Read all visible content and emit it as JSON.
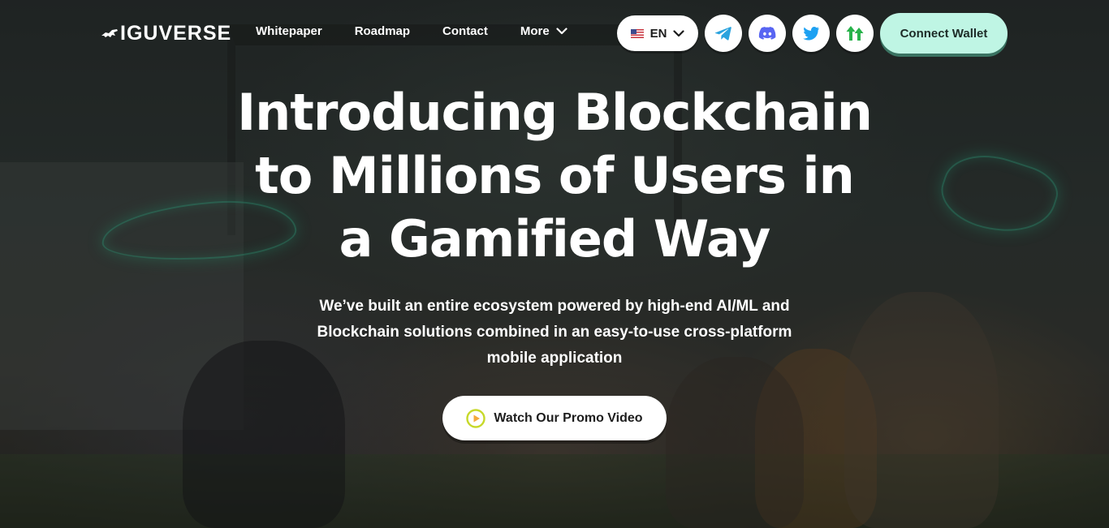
{
  "brand": {
    "logo_text": "IGUVERSE"
  },
  "nav": {
    "items": [
      {
        "label": "Whitepaper"
      },
      {
        "label": "Roadmap"
      },
      {
        "label": "Contact"
      },
      {
        "label": "More",
        "icon": "chevron-down-icon"
      }
    ]
  },
  "language": {
    "flag": "us-flag-icon",
    "label": "EN",
    "icon": "chevron-down-icon"
  },
  "social": [
    {
      "icon": "telegram-icon",
      "color": "#2aa3de"
    },
    {
      "icon": "discord-icon",
      "color": "#5865f2"
    },
    {
      "icon": "twitter-icon",
      "color": "#1da1f2"
    },
    {
      "icon": "upvote-arrows-icon",
      "color": "#27b24a"
    }
  ],
  "connect_wallet": {
    "label": "Connect Wallet",
    "color": "#bff5e4"
  },
  "hero": {
    "title_lines": [
      "Introducing Blockchain",
      "to Millions of Users in",
      "a Gamified Way"
    ],
    "subtitle_lines": [
      "We’ve built an entire ecosystem powered by high-end AI/ML and",
      "Blockchain solutions combined in an easy-to-use cross-platform",
      "mobile application"
    ],
    "promo_button": {
      "label": "Watch Our Promo Video",
      "icon": "play-icon",
      "icon_color": "#c7d92a"
    }
  }
}
